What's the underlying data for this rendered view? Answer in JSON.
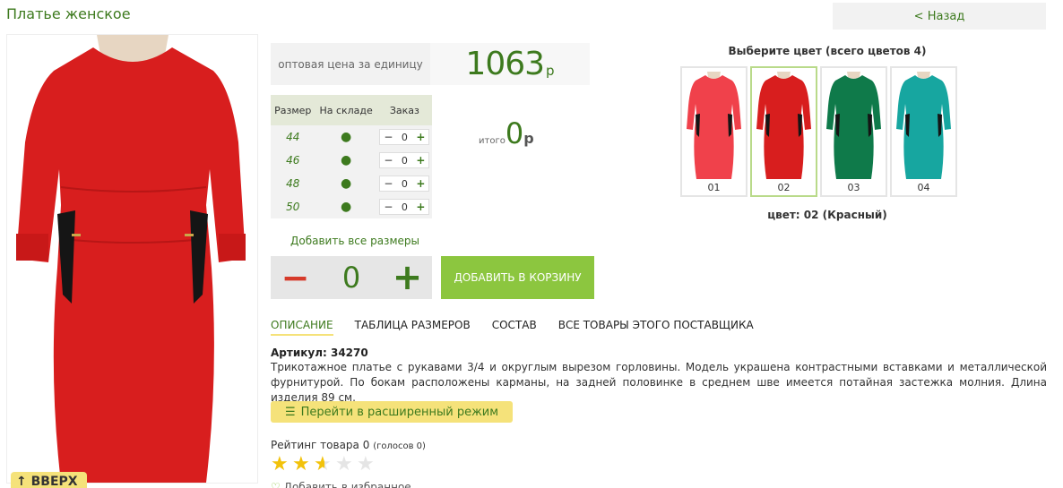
{
  "header": {
    "title": "Платье женское",
    "back_label": "< Назад"
  },
  "product_image": {
    "description_color": "#d81e1e",
    "up_button_label": "↑ ВВЕРХ"
  },
  "price": {
    "label": "оптовая цена за единицу",
    "value": "1063",
    "currency": "р"
  },
  "size_table": {
    "headers": [
      "Размер",
      "На складе",
      "Заказ"
    ],
    "rows": [
      {
        "size": "44",
        "stock": "●",
        "qty": "0"
      },
      {
        "size": "46",
        "stock": "●",
        "qty": "0"
      },
      {
        "size": "48",
        "stock": "●",
        "qty": "0"
      },
      {
        "size": "50",
        "stock": "●",
        "qty": "0"
      }
    ],
    "minus": "−",
    "plus": "+"
  },
  "total": {
    "label": "итого",
    "value": "0",
    "currency": "р"
  },
  "add_all_label": "Добавить все размеры",
  "quantity": {
    "minus": "−",
    "value": "0",
    "plus": "+"
  },
  "add_to_cart_label": "ДОБАВИТЬ В КОРЗИНУ",
  "tabs": [
    {
      "label": "ОПИСАНИЕ",
      "active": true
    },
    {
      "label": "ТАБЛИЦА РАЗМЕРОВ",
      "active": false
    },
    {
      "label": "СОСТАВ",
      "active": false
    },
    {
      "label": "ВСЕ ТОВАРЫ ЭТОГО ПОСТАВЩИКА",
      "active": false
    }
  ],
  "sku_label": "Артикул: 34270",
  "description": "Трикотажное платье с рукавами 3/4 и округлым вырезом горловины. Модель украшена контрастными вставками и металлической фурнитурой. По бокам расположены карманы, на задней половинке в среднем шве имеется потайная застежка молния. Длина изделия 89 см.",
  "advanced_mode_label": "Перейти в расширенный режим",
  "rating": {
    "label": "Рейтинг товара 0",
    "votes": "(голосов 0)",
    "stars_filled": 2.5,
    "stars_total": 5
  },
  "favorite_label": "Добавить в избранное",
  "colors": {
    "title": "Выберите цвет (всего цветов 4)",
    "items": [
      {
        "label": "01",
        "color": "#f0414b"
      },
      {
        "label": "02",
        "color": "#d81e1e"
      },
      {
        "label": "03",
        "color": "#0f7a4a"
      },
      {
        "label": "04",
        "color": "#17a6a0"
      }
    ],
    "selected_index": 1,
    "caption": "цвет: 02 (Красный)"
  }
}
